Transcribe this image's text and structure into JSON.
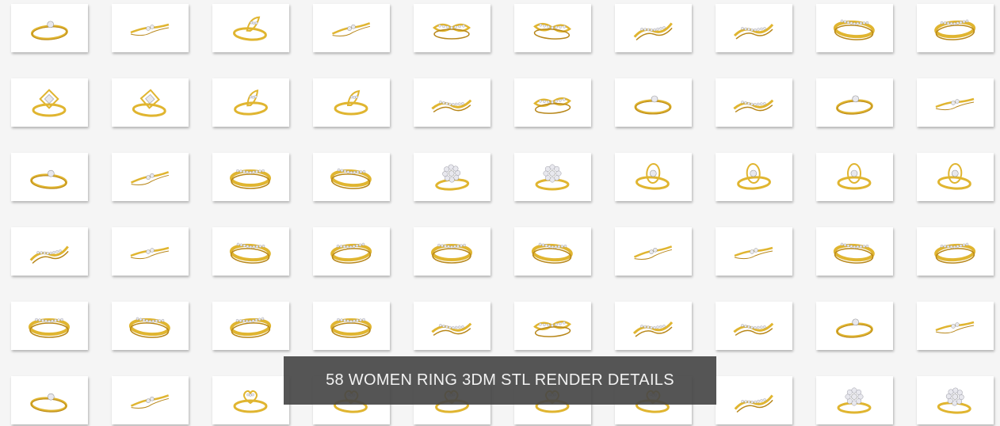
{
  "banner": {
    "title": "58 WOMEN RING 3DM STL RENDER DETAILS"
  },
  "colors": {
    "page_background": "#f5f5f5",
    "tile_background": "#ffffff",
    "gold": "#e0b530",
    "gold_dark": "#b8871a",
    "diamond": "#e8e8ee",
    "banner_background": "#464646",
    "banner_text": "#f2f2f2"
  },
  "gallery": {
    "rows": 6,
    "columns": 10,
    "tiles": [
      {
        "icon": "ring-solitaire-icon"
      },
      {
        "icon": "ring-bypass-icon"
      },
      {
        "icon": "ring-leaf-icon"
      },
      {
        "icon": "ring-bypass-icon"
      },
      {
        "icon": "ring-infinity-icon"
      },
      {
        "icon": "ring-infinity-icon"
      },
      {
        "icon": "ring-wave-icon"
      },
      {
        "icon": "ring-wave-icon"
      },
      {
        "icon": "ring-band-icon"
      },
      {
        "icon": "ring-band-icon"
      },
      {
        "icon": "ring-square-halo-icon"
      },
      {
        "icon": "ring-square-halo-icon"
      },
      {
        "icon": "ring-leaf-icon"
      },
      {
        "icon": "ring-leaf-icon"
      },
      {
        "icon": "ring-wave-icon"
      },
      {
        "icon": "ring-infinity-icon"
      },
      {
        "icon": "ring-solitaire-icon"
      },
      {
        "icon": "ring-wave-icon"
      },
      {
        "icon": "ring-solitaire-icon"
      },
      {
        "icon": "ring-bypass-icon"
      },
      {
        "icon": "ring-solitaire-icon"
      },
      {
        "icon": "ring-bypass-icon"
      },
      {
        "icon": "ring-band-icon"
      },
      {
        "icon": "ring-band-icon"
      },
      {
        "icon": "ring-flower-icon"
      },
      {
        "icon": "ring-flower-icon"
      },
      {
        "icon": "ring-halo-icon"
      },
      {
        "icon": "ring-halo-icon"
      },
      {
        "icon": "ring-halo-icon"
      },
      {
        "icon": "ring-halo-icon"
      },
      {
        "icon": "ring-wave-icon"
      },
      {
        "icon": "ring-bypass-icon"
      },
      {
        "icon": "ring-band-icon"
      },
      {
        "icon": "ring-band-icon"
      },
      {
        "icon": "ring-band-icon"
      },
      {
        "icon": "ring-band-icon"
      },
      {
        "icon": "ring-bypass-icon"
      },
      {
        "icon": "ring-bypass-icon"
      },
      {
        "icon": "ring-band-icon"
      },
      {
        "icon": "ring-band-icon"
      },
      {
        "icon": "ring-band-icon"
      },
      {
        "icon": "ring-band-icon"
      },
      {
        "icon": "ring-band-icon"
      },
      {
        "icon": "ring-band-icon"
      },
      {
        "icon": "ring-wave-icon"
      },
      {
        "icon": "ring-infinity-icon"
      },
      {
        "icon": "ring-wave-icon"
      },
      {
        "icon": "ring-wave-icon"
      },
      {
        "icon": "ring-solitaire-icon"
      },
      {
        "icon": "ring-bypass-icon"
      },
      {
        "icon": "ring-solitaire-icon"
      },
      {
        "icon": "ring-bypass-icon"
      },
      {
        "icon": "ring-heart-icon"
      },
      {
        "icon": "ring-heart-icon"
      },
      {
        "icon": "ring-heart-icon"
      },
      {
        "icon": "ring-heart-icon"
      },
      {
        "icon": "ring-heart-icon"
      },
      {
        "icon": "ring-wave-icon"
      },
      {
        "icon": "ring-flower-icon"
      },
      {
        "icon": "ring-flower-icon"
      }
    ]
  }
}
